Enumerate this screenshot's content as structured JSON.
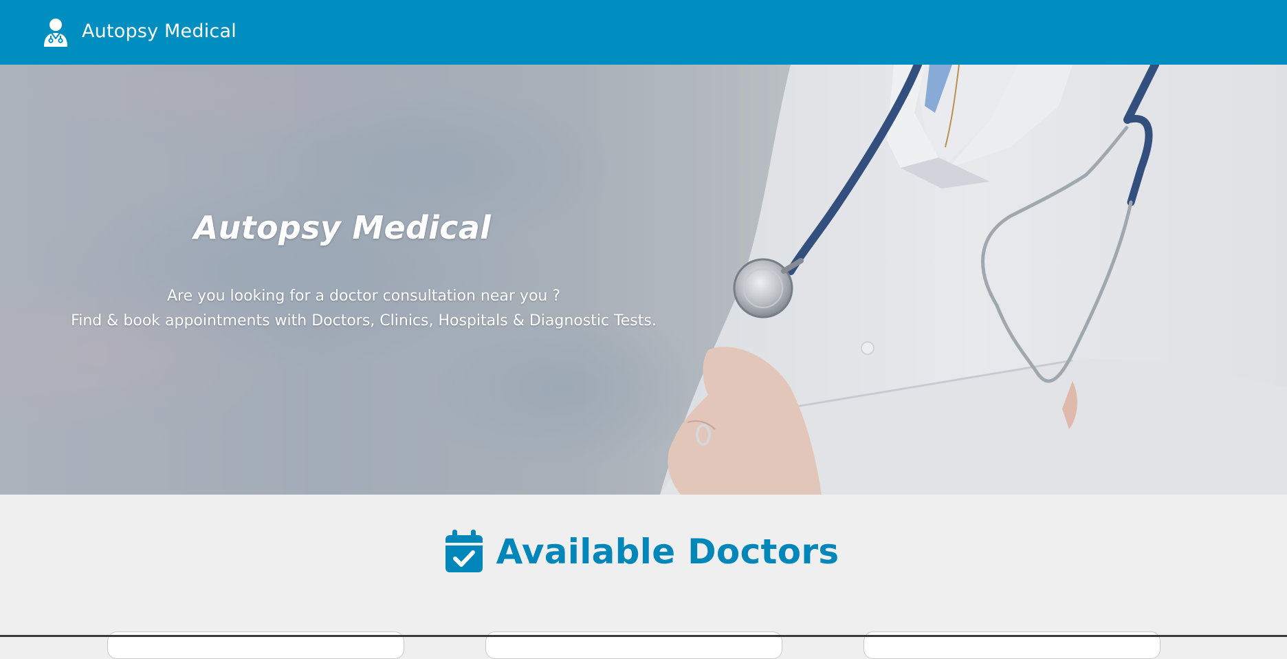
{
  "header": {
    "brand_text": "Autopsy Medical",
    "brand_icon": "doctor-icon",
    "background_color": "#008ec0"
  },
  "hero": {
    "title": "Autopsy Medical",
    "line1": "Are you looking for a doctor consultation near you ?",
    "line2": "Find & book appointments with Doctors, Clinics, Hospitals & Diagnostic Tests.",
    "image": "doctor-with-stethoscope-photo"
  },
  "section": {
    "title": "Available Doctors",
    "icon": "calendar-check-icon",
    "title_color": "#0086b8"
  }
}
